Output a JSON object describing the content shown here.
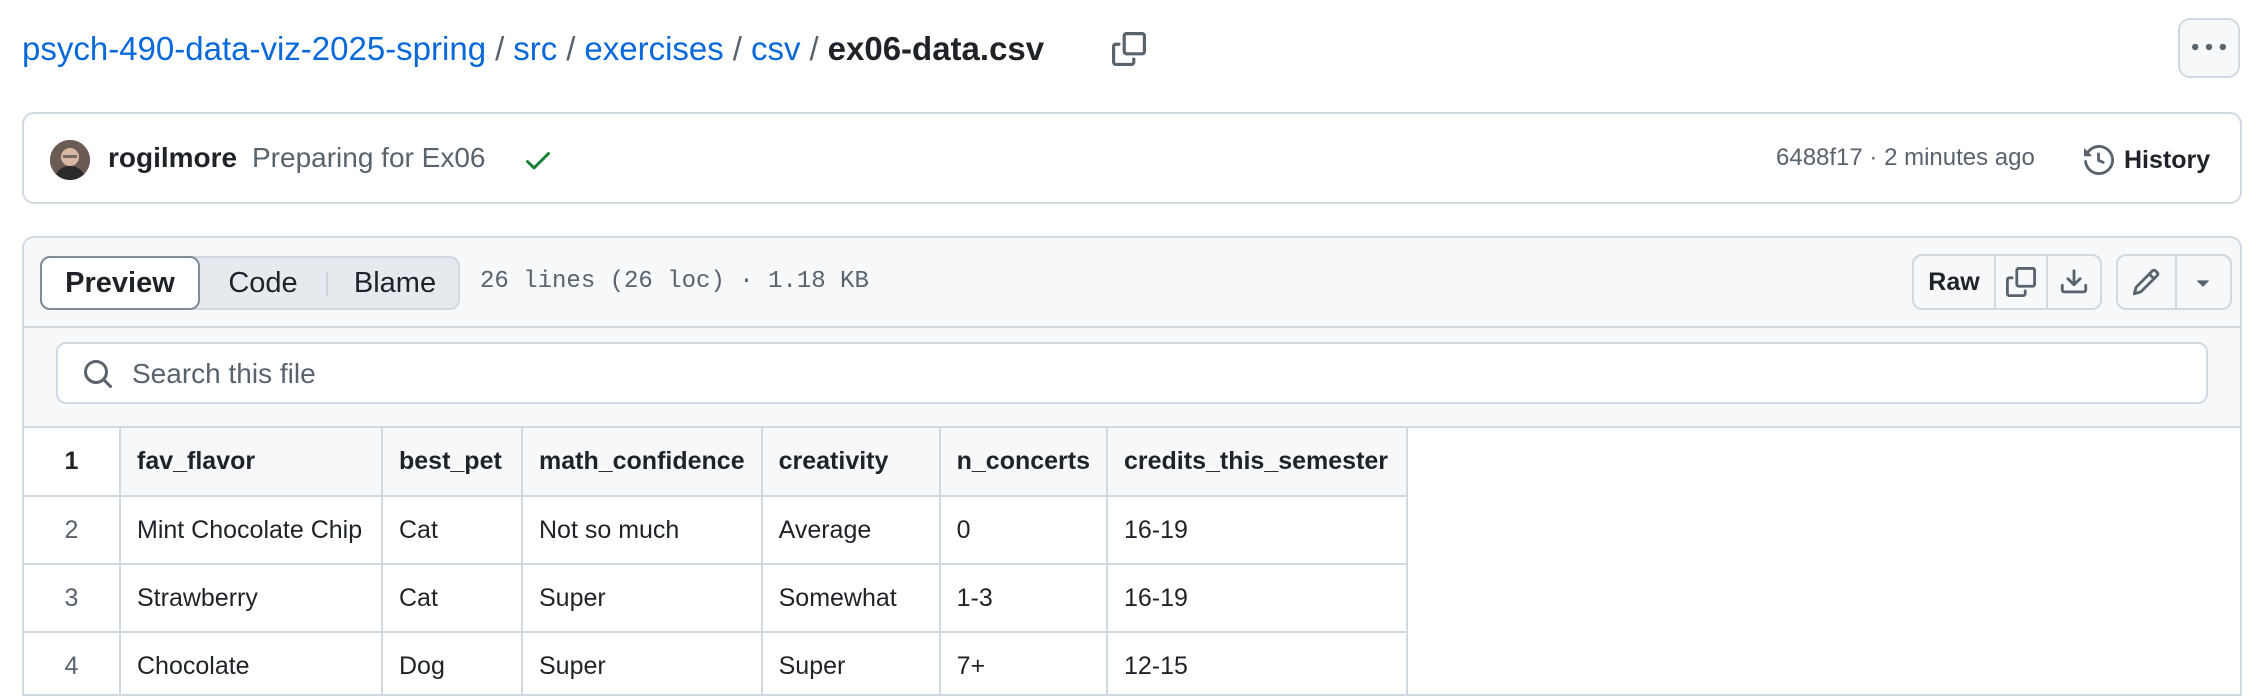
{
  "breadcrumb": {
    "repo": "psych-490-data-viz-2025-spring",
    "parts": [
      "src",
      "exercises",
      "csv"
    ],
    "separator": "/",
    "current": "ex06-data.csv"
  },
  "commit": {
    "author": "rogilmore",
    "message": "Preparing for Ex06",
    "status": "success",
    "hash": "6488f17",
    "time": "2 minutes ago",
    "meta": "6488f17 · 2 minutes ago",
    "history_label": "History"
  },
  "file_header": {
    "tabs": [
      "Preview",
      "Code",
      "Blame"
    ],
    "active_tab": "Preview",
    "info": "26 lines (26 loc) · 1.18 KB",
    "raw_label": "Raw"
  },
  "search": {
    "placeholder": "Search this file",
    "value": ""
  },
  "table": {
    "header_line": "1",
    "columns": [
      "fav_flavor",
      "best_pet",
      "math_confidence",
      "creativity",
      "n_concerts",
      "credits_this_semester"
    ],
    "rows": [
      {
        "line": "2",
        "cells": [
          "Mint Chocolate Chip",
          "Cat",
          "Not so much",
          "Average",
          "0",
          "16-19"
        ]
      },
      {
        "line": "3",
        "cells": [
          "Strawberry",
          "Cat",
          "Super",
          "Somewhat",
          "1-3",
          "16-19"
        ]
      },
      {
        "line": "4",
        "cells": [
          "Chocolate",
          "Dog",
          "Super",
          "Super",
          "7+",
          "12-15"
        ]
      }
    ]
  },
  "icons": {
    "copy": "copy-icon",
    "more": "kebab-horizontal-icon",
    "check": "check-icon",
    "history": "history-icon",
    "download": "download-icon",
    "edit": "pencil-icon",
    "dropdown": "triangle-down-icon",
    "search": "search-icon"
  },
  "colors": {
    "link": "#0969da",
    "success": "#1a7f37",
    "border": "#d1d9e0",
    "muted": "#59636e"
  }
}
